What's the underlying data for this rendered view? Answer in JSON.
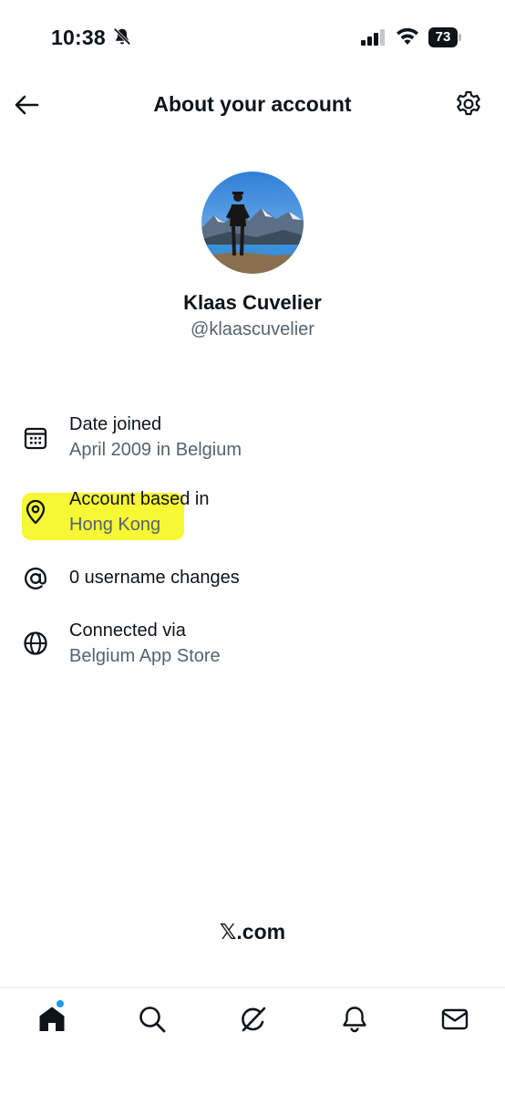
{
  "status_bar": {
    "time": "10:38",
    "battery": "73"
  },
  "header": {
    "title": "About your account"
  },
  "profile": {
    "name": "Klaas Cuvelier",
    "handle": "@klaascuvelier"
  },
  "info_rows": [
    {
      "icon": "calendar-icon",
      "title": "Date joined",
      "value": "April 2009 in Belgium"
    },
    {
      "icon": "location-pin-icon",
      "title": "Account based in",
      "value": "Hong Kong",
      "highlighted": true,
      "highlight_color": "#f5f82a"
    },
    {
      "icon": "at-sign-icon",
      "title": "0 username changes"
    },
    {
      "icon": "globe-icon",
      "title": "Connected via",
      "value": "Belgium App Store"
    }
  ],
  "footer": {
    "brand": "𝕏.com"
  },
  "bottom_nav": [
    {
      "icon": "home-icon",
      "active": true,
      "badge": true
    },
    {
      "icon": "search-icon"
    },
    {
      "icon": "grok-icon"
    },
    {
      "icon": "notifications-bell-icon"
    },
    {
      "icon": "messages-mail-icon"
    }
  ],
  "colors": {
    "text_primary": "#0f1419",
    "text_secondary": "#536471",
    "accent_blue": "#1d9bf0",
    "highlight_yellow": "#f5f82a"
  }
}
